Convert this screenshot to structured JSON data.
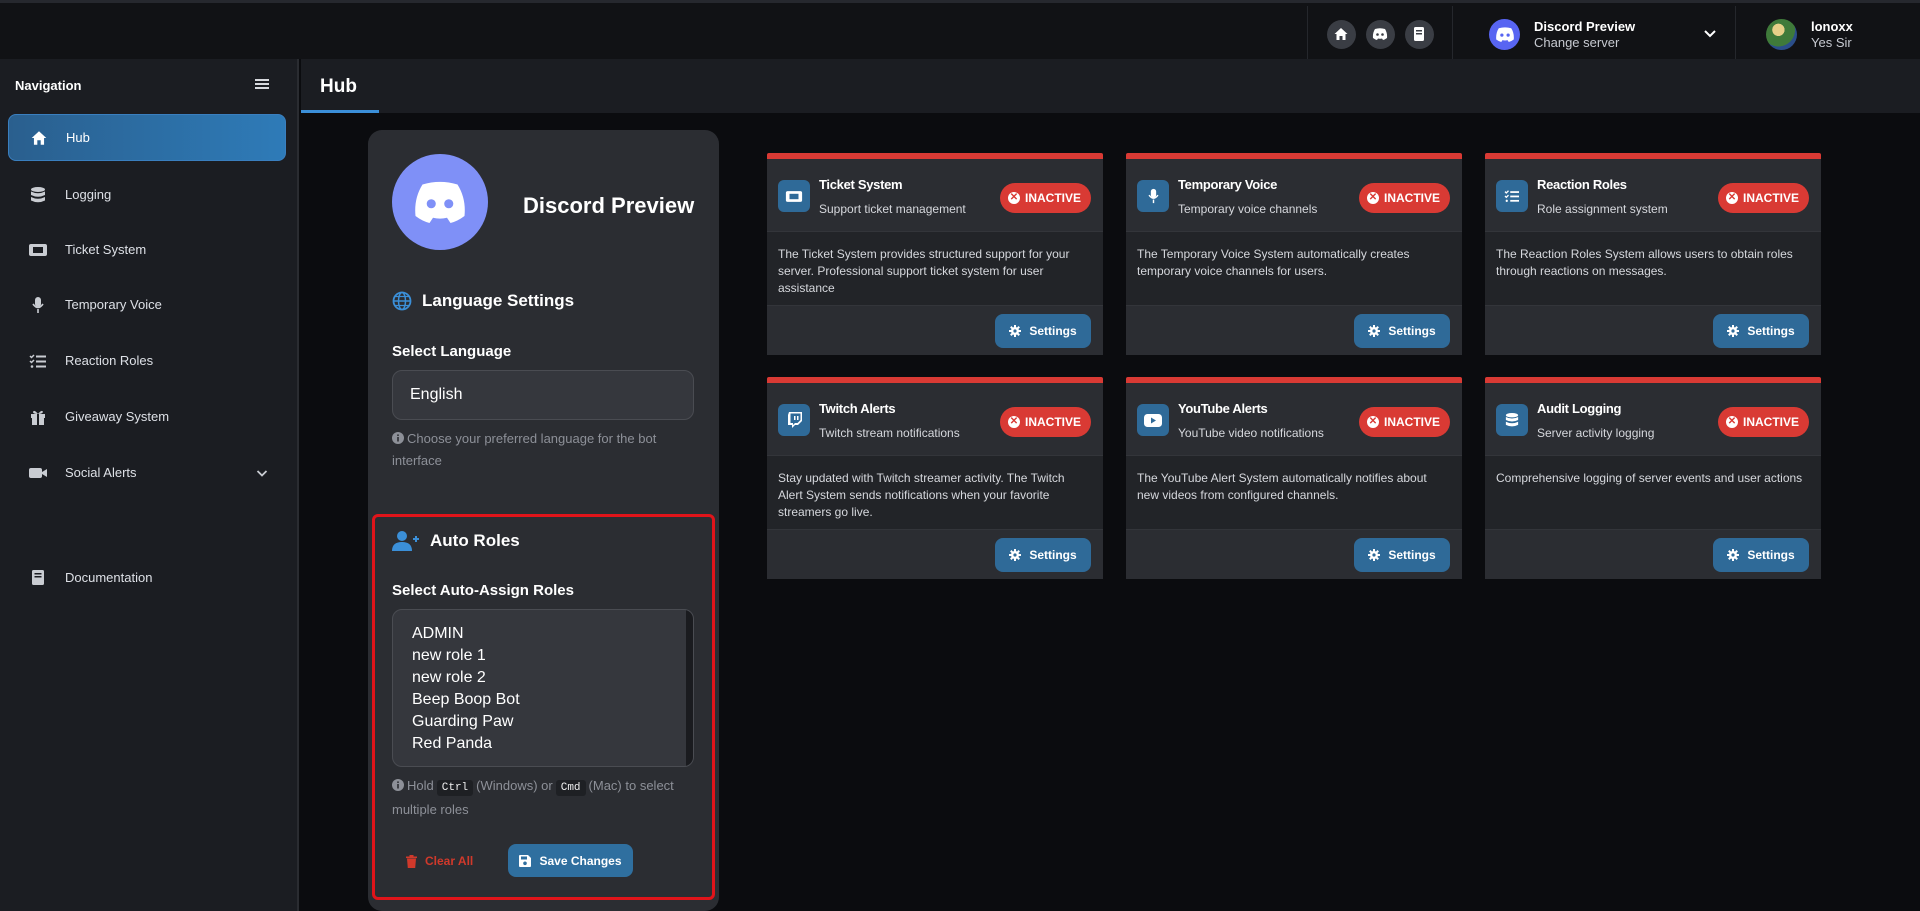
{
  "topbar": {
    "icons": [
      "home-icon",
      "discord-icon",
      "book-icon"
    ],
    "server_name": "Discord Preview",
    "server_action": "Change server",
    "user_name": "lonoxx",
    "user_subtitle": "Yes Sir"
  },
  "sidebar": {
    "heading": "Navigation",
    "items": [
      {
        "label": "Hub",
        "icon": "home-icon",
        "active": true
      },
      {
        "label": "Logging",
        "icon": "database-icon"
      },
      {
        "label": "Ticket System",
        "icon": "ticket-icon"
      },
      {
        "label": "Temporary Voice",
        "icon": "microphone-icon"
      },
      {
        "label": "Reaction Roles",
        "icon": "list-check-icon"
      },
      {
        "label": "Giveaway System",
        "icon": "gift-icon"
      },
      {
        "label": "Social Alerts",
        "icon": "video-icon"
      },
      {
        "label": "Documentation",
        "icon": "book-icon"
      }
    ]
  },
  "main": {
    "title": "Hub"
  },
  "panel": {
    "server_name": "Discord Preview",
    "language": {
      "title": "Language Settings",
      "label": "Select Language",
      "value": "English",
      "hint": "Choose your preferred language for the bot interface"
    },
    "auto_roles": {
      "title": "Auto Roles",
      "label": "Select Auto-Assign Roles",
      "roles": [
        "ADMIN",
        "new role 1",
        "new role 2",
        "Beep Boop Bot",
        "Guarding Paw",
        "Red Panda"
      ],
      "hint_prefix": "Hold",
      "key_ctrl": "Ctrl",
      "hint_mid": "(Windows) or",
      "key_cmd": "Cmd",
      "hint_suffix": "(Mac) to select multiple roles",
      "clear_label": "Clear All",
      "save_label": "Save Changes"
    }
  },
  "cards": [
    {
      "title": "Ticket System",
      "subtitle": "Support ticket management",
      "status": "INACTIVE",
      "description": "The Ticket System provides structured support for your server. Professional support ticket system for user assistance",
      "button": "Settings",
      "icon": "ticket-icon"
    },
    {
      "title": "Temporary Voice",
      "subtitle": "Temporary voice channels",
      "status": "INACTIVE",
      "description": "The Temporary Voice System automatically creates temporary voice channels for users.",
      "button": "Settings",
      "icon": "microphone-icon"
    },
    {
      "title": "Reaction Roles",
      "subtitle": "Role assignment system",
      "status": "INACTIVE",
      "description": "The Reaction Roles System allows users to obtain roles through reactions on messages.",
      "button": "Settings",
      "icon": "list-check-icon"
    },
    {
      "title": "Twitch Alerts",
      "subtitle": "Twitch stream notifications",
      "status": "INACTIVE",
      "description": "Stay updated with Twitch streamer activity. The Twitch Alert System sends notifications when your favorite streamers go live.",
      "button": "Settings",
      "icon": "twitch-icon"
    },
    {
      "title": "YouTube Alerts",
      "subtitle": "YouTube video notifications",
      "status": "INACTIVE",
      "description": "The YouTube Alert System automatically notifies about new videos from configured channels.",
      "button": "Settings",
      "icon": "youtube-icon"
    },
    {
      "title": "Audit Logging",
      "subtitle": "Server activity logging",
      "status": "INACTIVE",
      "description": "Comprehensive logging of server events and user actions",
      "button": "Settings",
      "icon": "database-icon"
    }
  ],
  "colors": {
    "accent": "#2f6a98",
    "inactive": "#d93a34",
    "highlight_box": "#e0141a",
    "discord": "#5865f2"
  }
}
